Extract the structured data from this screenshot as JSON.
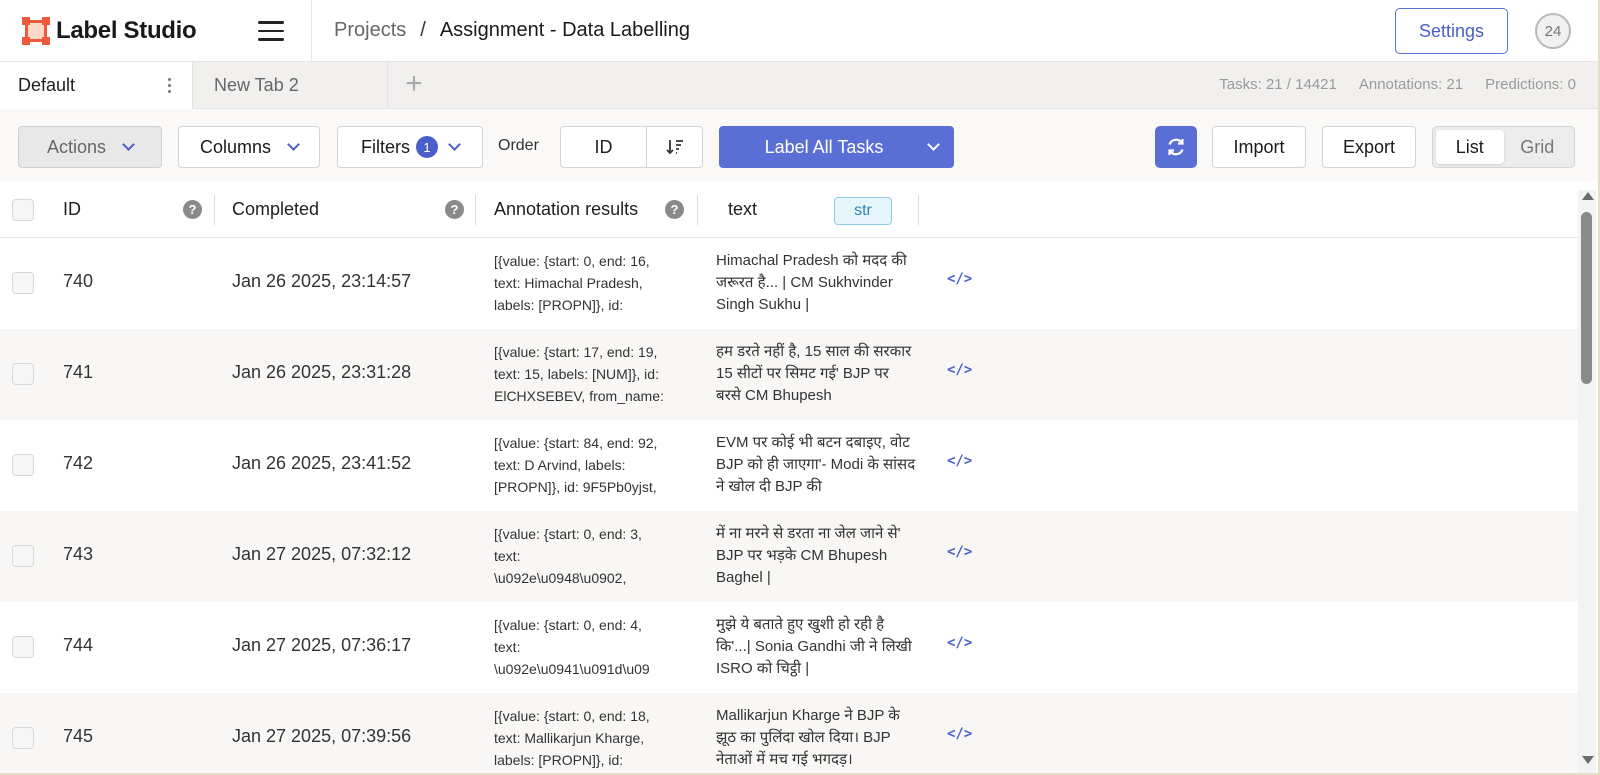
{
  "app": {
    "name": "Label Studio"
  },
  "header": {
    "breadcrumb": {
      "projects": "Projects",
      "separator": "/",
      "current": "Assignment - Data Labelling"
    },
    "settings_label": "Settings",
    "avatar_text": "24"
  },
  "tabs": {
    "items": [
      {
        "label": "Default",
        "active": true
      },
      {
        "label": "New Tab 2",
        "active": false
      }
    ],
    "add_icon": "plus-icon"
  },
  "stats": {
    "tasks": "Tasks: 21 / 14421",
    "annotations": "Annotations: 21",
    "predictions": "Predictions: 0"
  },
  "toolbar": {
    "actions_label": "Actions",
    "columns_label": "Columns",
    "filters_label": "Filters",
    "filters_count": "1",
    "order_label": "Order",
    "order_field": "ID",
    "label_all_label": "Label All Tasks",
    "import_label": "Import",
    "export_label": "Export",
    "view_list": "List",
    "view_grid": "Grid"
  },
  "table": {
    "columns": {
      "id": "ID",
      "completed": "Completed",
      "annotation_results": "Annotation results",
      "text": "text",
      "text_type": "str"
    },
    "help_glyph": "?",
    "rows": [
      {
        "id": "740",
        "completed": "Jan 26 2025, 23:14:57",
        "annotation": "[{value: {start: 0, end: 16,\ntext: Himachal Pradesh,\nlabels: [PROPN]}, id:",
        "text": "Himachal Pradesh को मदद की जरूरत है... | CM Sukhvinder Singh Sukhu |",
        "code": "</>"
      },
      {
        "id": "741",
        "completed": "Jan 26 2025, 23:31:28",
        "annotation": "[{value: {start: 17, end: 19,\ntext: 15, labels: [NUM]}, id:\nElCHXSEBEV, from_name:",
        "text": "हम डरते नहीं है, 15 साल की सरकार 15 सीटों पर सिमट गई' BJP पर बरसे CM Bhupesh",
        "code": "</>"
      },
      {
        "id": "742",
        "completed": "Jan 26 2025, 23:41:52",
        "annotation": "[{value: {start: 84, end: 92,\ntext: D Arvind, labels:\n[PROPN]}, id: 9F5Pb0yjst,",
        "text": "EVM पर कोई भी बटन दबाइए, वोट BJP को ही जाएगा'- Modi के सांसद ने खोल दी BJP की",
        "code": "</>"
      },
      {
        "id": "743",
        "completed": "Jan 27 2025, 07:32:12",
        "annotation": "[{value: {start: 0, end: 3,\ntext:\n\\u092e\\u0948\\u0902,",
        "text": "में ना मरने से डरता ना जेल जाने से' BJP पर भड़के CM Bhupesh Baghel |",
        "code": "</>"
      },
      {
        "id": "744",
        "completed": "Jan 27 2025, 07:36:17",
        "annotation": "[{value: {start: 0, end: 4,\ntext:\n\\u092e\\u0941\\u091d\\u09",
        "text": "मुझे ये बताते हुए खुशी हो रही है कि'...| Sonia Gandhi जी ने लिखी ISRO को चिट्ठी |",
        "code": "</>"
      },
      {
        "id": "745",
        "completed": "Jan 27 2025, 07:39:56",
        "annotation": "[{value: {start: 0, end: 18,\ntext: Mallikarjun Kharge,\nlabels: [PROPN]}, id:",
        "text": "Mallikarjun Kharge ने BJP के झूठ का पुलिंदा खोल दिया। BJP नेताओं में मच गई भगदड़।",
        "code": "</>"
      }
    ]
  },
  "colors": {
    "accent": "#5a6fd6",
    "logo": "#f05a3b",
    "str_tag": "#2f86b8"
  }
}
